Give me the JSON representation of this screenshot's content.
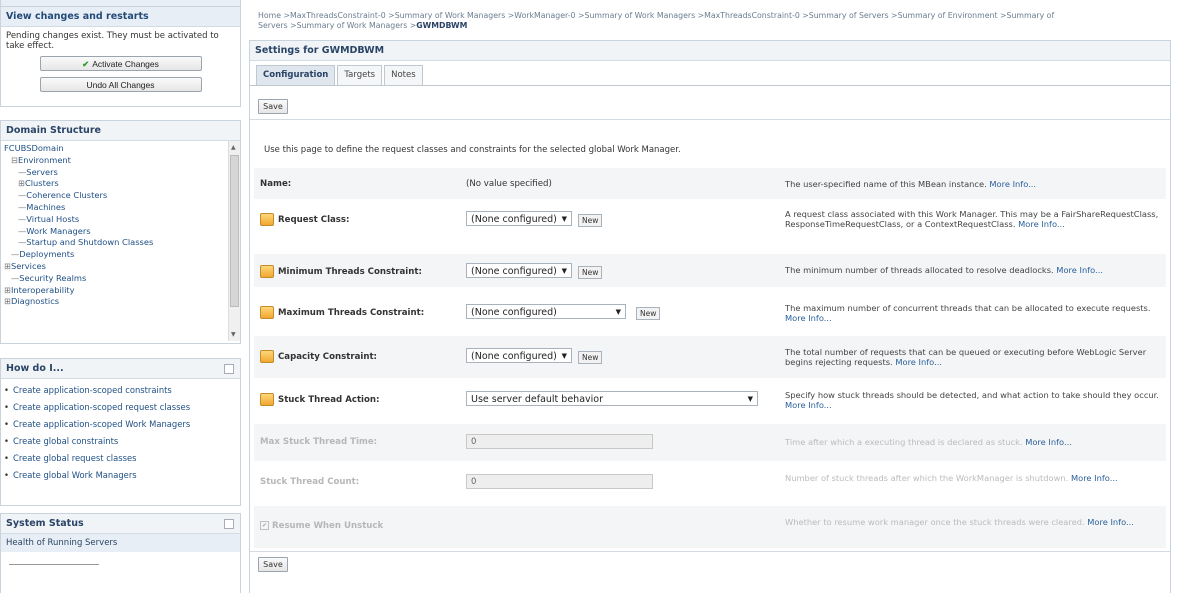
{
  "change_center": {
    "title": "View changes and restarts",
    "message": "Pending changes exist. They must be activated to take effect.",
    "activate_label": "Activate Changes",
    "undo_label": "Undo All Changes"
  },
  "domain_structure": {
    "title": "Domain Structure",
    "tree": [
      {
        "text": "FCUBSDomain",
        "indent": 0,
        "prefix": ""
      },
      {
        "text": "Environment",
        "indent": 1,
        "prefix": "⊟"
      },
      {
        "text": "Servers",
        "indent": 2,
        "prefix": "—"
      },
      {
        "text": "Clusters",
        "indent": 2,
        "prefix": "⊞"
      },
      {
        "text": "Coherence Clusters",
        "indent": 2,
        "prefix": "—"
      },
      {
        "text": "Machines",
        "indent": 2,
        "prefix": "—"
      },
      {
        "text": "Virtual Hosts",
        "indent": 2,
        "prefix": "—"
      },
      {
        "text": "Work Managers",
        "indent": 2,
        "prefix": "—"
      },
      {
        "text": "Startup and Shutdown Classes",
        "indent": 2,
        "prefix": "—"
      },
      {
        "text": "Deployments",
        "indent": 1,
        "prefix": "—"
      },
      {
        "text": "Services",
        "indent": 0,
        "prefix": "⊞"
      },
      {
        "text": "Security Realms",
        "indent": 1,
        "prefix": "—"
      },
      {
        "text": "Interoperability",
        "indent": 0,
        "prefix": "⊞"
      },
      {
        "text": "Diagnostics",
        "indent": 0,
        "prefix": "⊞"
      }
    ]
  },
  "how_do_i": {
    "title": "How do I...",
    "items": [
      "Create application-scoped constraints",
      "Create application-scoped request classes",
      "Create application-scoped Work Managers",
      "Create global constraints",
      "Create global request classes",
      "Create global Work Managers"
    ]
  },
  "system_status": {
    "title": "System Status",
    "subtitle": "Health of Running Servers"
  },
  "breadcrumb": {
    "line1": "Home >MaxThreadsConstraint-0 >Summary of Work Managers >WorkManager-0 >Summary of Work Managers >MaxThreadsConstraint-0 >Summary of Servers >Summary of Environment >Summary of",
    "line2_prefix": "Servers >Summary of Work Managers >",
    "line2_current": "GWMDBWM"
  },
  "settings": {
    "title": "Settings for GWMDBWM",
    "tabs": [
      "Configuration",
      "Targets",
      "Notes"
    ],
    "save_label": "Save",
    "intro": "Use this page to define the request classes and constraints for the selected global Work Manager.",
    "more_info": "More Info...",
    "rows": {
      "name": {
        "label": "Name:",
        "value": "(No value specified)",
        "desc": "The user-specified name of this MBean instance."
      },
      "request_class": {
        "label": "Request Class:",
        "value": "(None configured)",
        "new": "New",
        "desc": "A request class associated with this Work Manager. This may be a FairShareRequestClass, ResponseTimeRequestClass, or a ContextRequestClass."
      },
      "min_threads": {
        "label": "Minimum Threads Constraint:",
        "value": "(None configured)",
        "new": "New",
        "desc": "The minimum number of threads allocated to resolve deadlocks."
      },
      "max_threads": {
        "label": "Maximum Threads Constraint:",
        "value": "(None configured)",
        "new": "New",
        "desc": "The maximum number of concurrent threads that can be allocated to execute requests."
      },
      "capacity": {
        "label": "Capacity Constraint:",
        "value": "(None configured)",
        "new": "New",
        "desc": "The total number of requests that can be queued or executing before WebLogic Server begins rejecting requests."
      },
      "stuck_action": {
        "label": "Stuck Thread Action:",
        "value": "Use server default behavior",
        "desc": "Specify how stuck threads should be detected, and what action to take should they occur."
      },
      "max_stuck_time": {
        "label": "Max Stuck Thread Time:",
        "value": "0",
        "desc": "Time after which a executing thread is declared as stuck."
      },
      "stuck_count": {
        "label": "Stuck Thread Count:",
        "value": "0",
        "desc": "Number of stuck threads after which the WorkManager is shutdown."
      },
      "resume": {
        "label": "Resume When Unstuck",
        "checked": true,
        "desc": "Whether to resume work manager once the stuck threads were cleared."
      }
    }
  }
}
